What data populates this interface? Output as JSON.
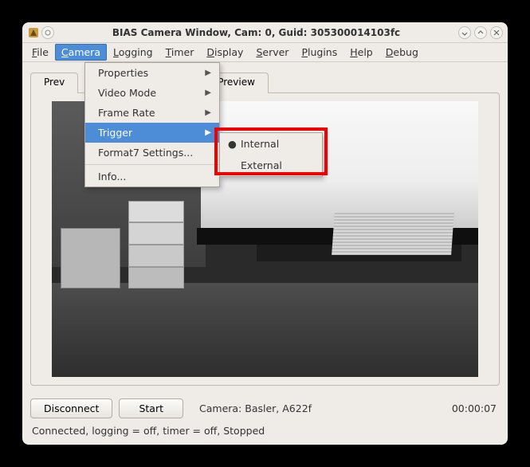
{
  "titlebar": {
    "title": "BIAS Camera Window, Cam: 0, Guid: 305300014103fc"
  },
  "menubar": {
    "file": "File",
    "camera": "Camera",
    "logging": "Logging",
    "timer": "Timer",
    "display": "Display",
    "server": "Server",
    "plugins": "Plugins",
    "help": "Help",
    "debug": "Debug"
  },
  "tabs": {
    "preview_left": "Prev",
    "preview_full": "Preview"
  },
  "dropdown": {
    "properties": "Properties",
    "video_mode": "Video Mode",
    "frame_rate": "Frame Rate",
    "trigger": "Trigger",
    "format7": "Format7 Settings...",
    "info": "Info..."
  },
  "submenu": {
    "internal": "Internal",
    "external": "External",
    "selected": "Internal"
  },
  "bottom": {
    "disconnect": "Disconnect",
    "start": "Start",
    "camera_label": "Camera: Basler,  A622f",
    "time": "00:00:07"
  },
  "statusbar": {
    "text": "Connected, logging = off, timer = off, Stopped"
  }
}
